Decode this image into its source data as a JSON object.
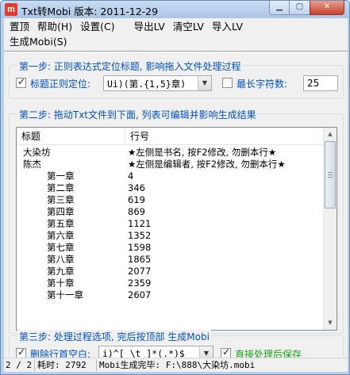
{
  "window": {
    "icon_letter": "m",
    "title": "Txt转Mobi  版本: 2011-12-29",
    "controls": {
      "minimize": "▁",
      "maximize": "▢",
      "close": "✕"
    }
  },
  "menu": {
    "row1": [
      "置顶",
      "帮助(H)",
      "设置(C)",
      "导出LV",
      "清空LV",
      "导入LV"
    ],
    "row2": [
      "生成Mobi(S)"
    ]
  },
  "step1": {
    "title": "第一步: 正则表达式定位标题, 影响拖入文件处理过程",
    "regex_checkbox_checked": true,
    "regex_label": "标题正则定位:",
    "regex_value": "Ui)(第.{1,5}章)",
    "maxlen_checkbox_checked": false,
    "maxlen_label": "最长字符数:",
    "maxlen_value": "25"
  },
  "step2": {
    "title": "第二步: 拖动Txt文件到下面, 列表可编辑并影响生成结果",
    "columns": [
      "标题",
      "行号"
    ],
    "rows": [
      {
        "title": "大染坊",
        "line": "★左侧是书名, 按F2修改, 勿删本行★",
        "indent": false
      },
      {
        "title": "陈杰",
        "line": "★左侧是编辑者, 按F2修改, 勿删本行★",
        "indent": false
      },
      {
        "title": "第一章",
        "line": "4",
        "indent": true
      },
      {
        "title": "第二章",
        "line": "346",
        "indent": true
      },
      {
        "title": "第三章",
        "line": "619",
        "indent": true
      },
      {
        "title": "第四章",
        "line": "869",
        "indent": true
      },
      {
        "title": "第五章",
        "line": "1121",
        "indent": true
      },
      {
        "title": "第六章",
        "line": "1352",
        "indent": true
      },
      {
        "title": "第七章",
        "line": "1598",
        "indent": true
      },
      {
        "title": "第八章",
        "line": "1865",
        "indent": true
      },
      {
        "title": "第九章",
        "line": "2077",
        "indent": true
      },
      {
        "title": "第十章",
        "line": "2359",
        "indent": true
      },
      {
        "title": "第十一章",
        "line": "2607",
        "indent": true
      }
    ]
  },
  "step3": {
    "title": "第三步: 处理过程选项, 完后按顶部 生成Mobi",
    "trim_checkbox_checked": true,
    "trim_label": "删除行首空白:",
    "trim_value": "i)^[ \\t  ]*(.*)$",
    "right_label_partial": "直接处理后保存"
  },
  "status": {
    "count": "2 / 2",
    "elapsed": "耗时: 2792",
    "message": "Mobi生成完毕: F:\\888\\大染坊.mobi"
  }
}
